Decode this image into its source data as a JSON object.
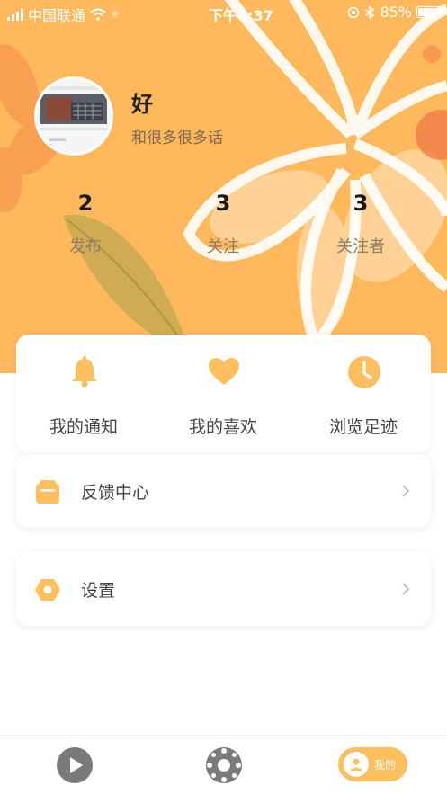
{
  "status_bar": {
    "carrier": "中国联通",
    "time": "下午4:37",
    "battery_text": "85%",
    "battery_level": 0.85
  },
  "profile": {
    "name": "好",
    "bio": "和很多很多话"
  },
  "stats": [
    {
      "value": "2",
      "label": "发布"
    },
    {
      "value": "3",
      "label": "关注"
    },
    {
      "value": "3",
      "label": "关注者"
    }
  ],
  "quick_actions": [
    {
      "label": "我的通知",
      "icon": "bell-icon"
    },
    {
      "label": "我的喜欢",
      "icon": "heart-icon"
    },
    {
      "label": "浏览足迹",
      "icon": "clock-icon"
    }
  ],
  "menu": [
    {
      "label": "反馈中心",
      "icon": "feedback-icon"
    },
    {
      "label": "设置",
      "icon": "settings-icon"
    }
  ],
  "tabbar": {
    "tabs": [
      {
        "icon": "play-icon"
      },
      {
        "icon": "discover-icon"
      },
      {
        "icon": "user-icon",
        "label": "我的"
      }
    ]
  },
  "colors": {
    "accent": "#ffbf5e",
    "hero_bg": "#ffb95c",
    "text_dark": "#1a1a1a",
    "text_muted": "#8c7a63"
  }
}
